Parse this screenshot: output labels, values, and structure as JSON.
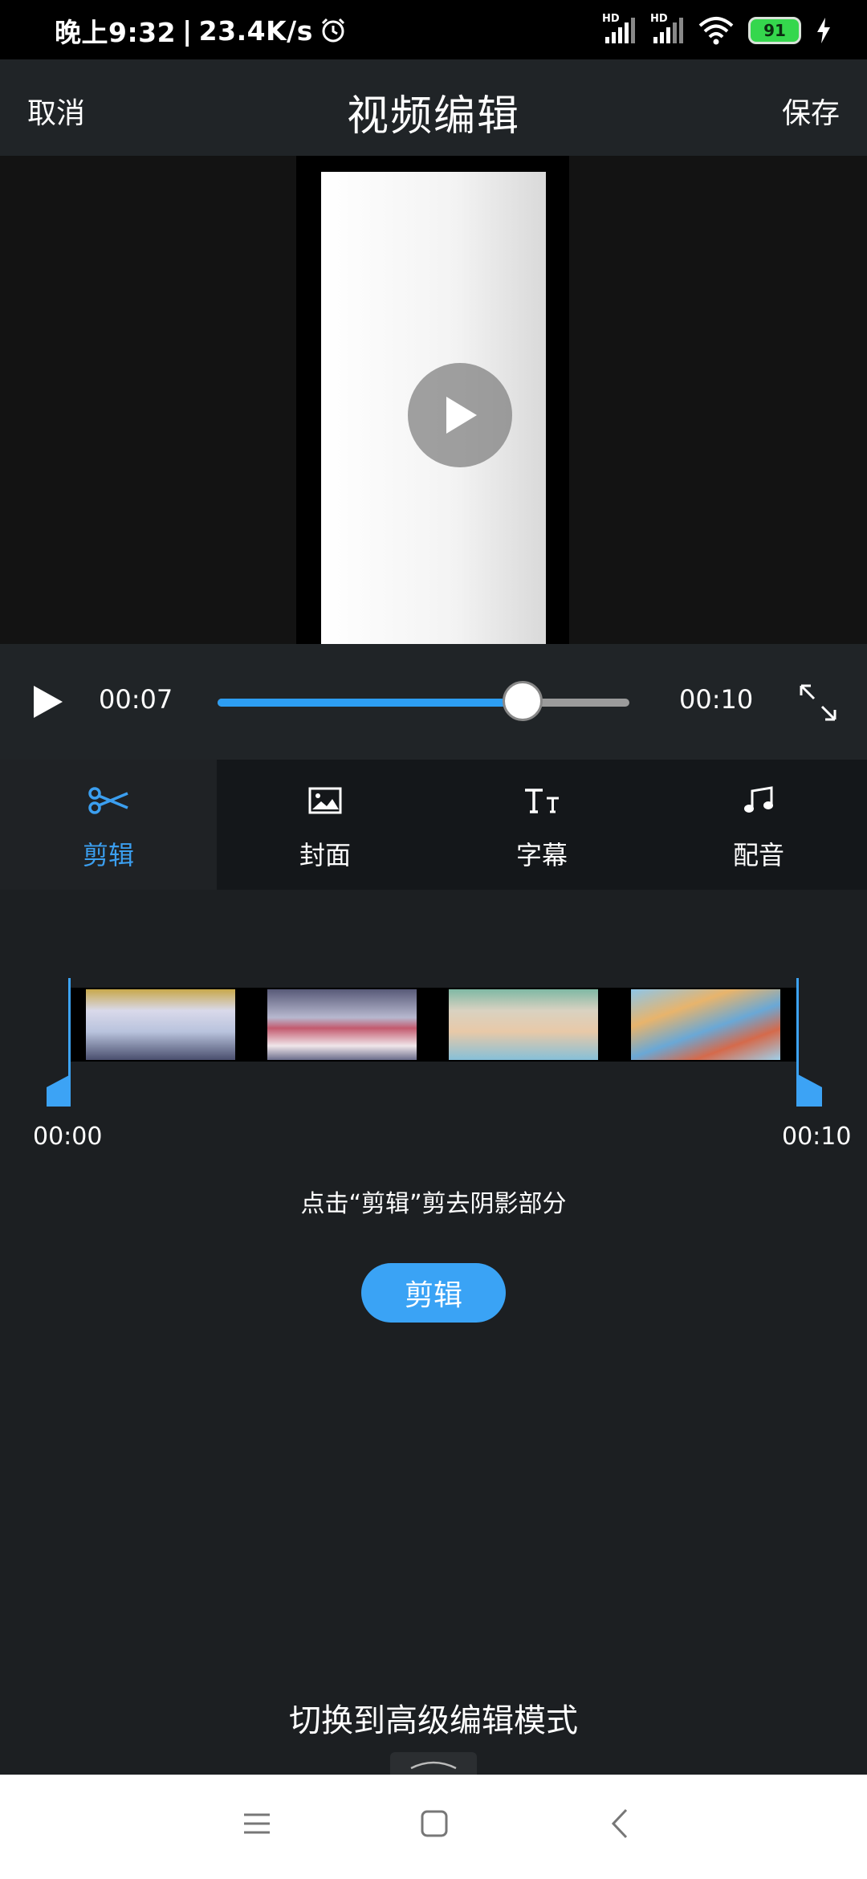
{
  "status_bar": {
    "time": "晚上9:32",
    "net_speed": "23.4K/s",
    "signal1": "HD",
    "signal2": "HD",
    "battery": "91"
  },
  "header": {
    "cancel_label": "取消",
    "title": "视频编辑",
    "save_label": "保存"
  },
  "player": {
    "current_time": "00:07",
    "total_time": "00:10",
    "progress": 0.74
  },
  "tabs": [
    {
      "label": "剪辑",
      "icon": "scissors-icon",
      "active": true
    },
    {
      "label": "封面",
      "icon": "image-icon",
      "active": false
    },
    {
      "label": "字幕",
      "icon": "text-size-icon",
      "active": false
    },
    {
      "label": "配音",
      "icon": "music-note-icon",
      "active": false
    }
  ],
  "timeline": {
    "start_time": "00:00",
    "end_time": "00:10",
    "hint": "点击“剪辑”剪去阴影部分",
    "trim_button": "剪辑"
  },
  "advanced_mode_label": "切换到高级编辑模式",
  "colors": {
    "accent": "#3aa3f5",
    "background": "#1c1f22"
  }
}
